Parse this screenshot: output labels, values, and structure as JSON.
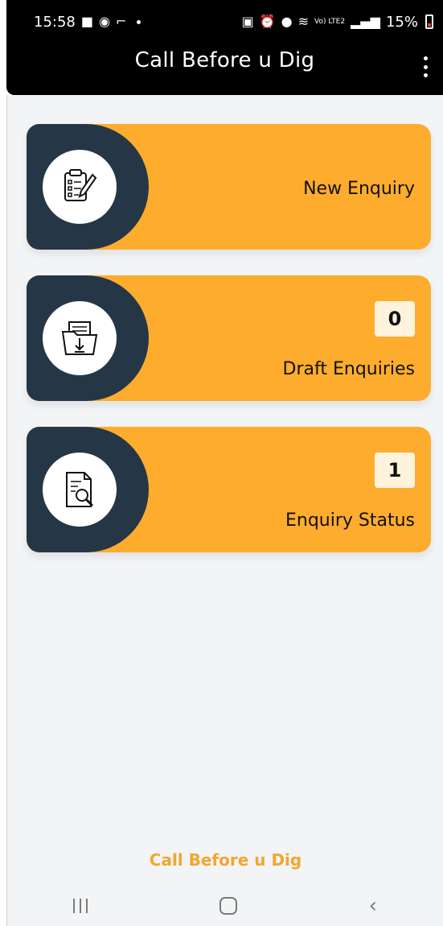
{
  "status_bar": {
    "time": "15:58",
    "icons_left": [
      "message-icon",
      "whatsapp-icon",
      "cast-icon"
    ],
    "icons_right": [
      "lock-icon",
      "alarm-icon",
      "location-icon",
      "wifi-icon",
      "signal-icon"
    ],
    "net_label": "Vo) LTE2",
    "battery": "15%"
  },
  "app_bar": {
    "title": "Call Before u Dig",
    "menu_icon": "kebab-menu-icon"
  },
  "cards": [
    {
      "label": "New Enquiry",
      "icon": "checklist-pencil-icon",
      "badge": null
    },
    {
      "label": "Draft Enquiries",
      "icon": "folder-download-icon",
      "badge": "0"
    },
    {
      "label": "Enquiry Status",
      "icon": "document-search-icon",
      "badge": "1"
    }
  ],
  "footer": {
    "text": "Call Before u Dig"
  },
  "nav": {
    "recents": "recents-icon",
    "home": "home-icon",
    "back": "back-icon"
  },
  "colors": {
    "card": "#feac2e",
    "wedge": "#253646",
    "footer_text": "#f2a62e",
    "background": "#f3f4f6"
  }
}
